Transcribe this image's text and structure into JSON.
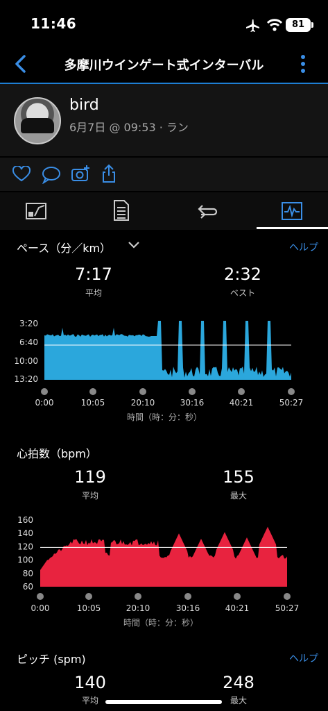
{
  "status": {
    "time": "11:46",
    "battery": "81"
  },
  "header": {
    "title": "多摩川ウインゲート式インターバル"
  },
  "profile": {
    "name": "bird",
    "meta": "6月7日 @ 09:53 · ラン"
  },
  "pace": {
    "title": "ペース（分／km）",
    "help": "ヘルプ",
    "avg_value": "7:17",
    "avg_label": "平均",
    "best_value": "2:32",
    "best_label": "ベスト",
    "axis_title": "時間（時：分：秒）",
    "chart_data": {
      "type": "area",
      "color": "#2ba7dc",
      "y_ticks": [
        "3:20",
        "6:40",
        "10:00",
        "13:20"
      ],
      "x_ticks": [
        "0:00",
        "10:05",
        "20:10",
        "30:16",
        "40:21",
        "50:27"
      ],
      "avg_line_label": "7:17"
    }
  },
  "hr": {
    "title": "心拍数（bpm）",
    "avg_value": "119",
    "avg_label": "平均",
    "max_value": "155",
    "max_label": "最大",
    "axis_title": "時間（時：分：秒）",
    "chart_data": {
      "type": "area",
      "color": "#e8233f",
      "y_ticks": [
        "160",
        "140",
        "120",
        "100",
        "80",
        "60"
      ],
      "x_ticks": [
        "0:00",
        "10:05",
        "20:10",
        "30:16",
        "40:21",
        "50:27"
      ],
      "avg_line": 119
    }
  },
  "cadence": {
    "title": "ピッチ (spm)",
    "help": "ヘルプ",
    "avg_value": "140",
    "avg_label": "平均",
    "max_value": "248",
    "max_label": "最大"
  }
}
